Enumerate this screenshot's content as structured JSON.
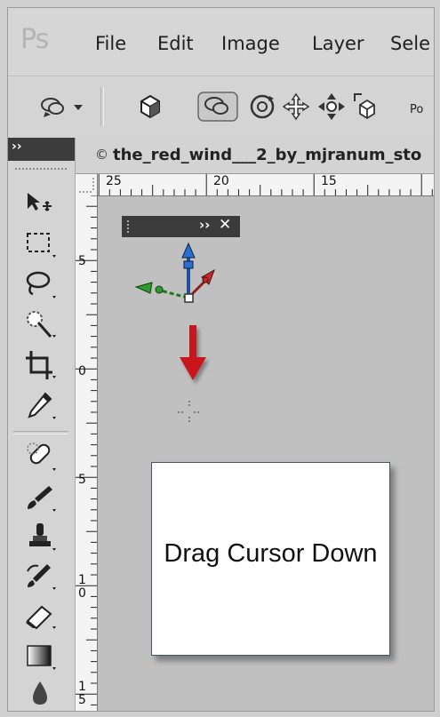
{
  "app": {
    "logo": "Ps"
  },
  "menu": {
    "items": [
      "File",
      "Edit",
      "Image",
      "Layer",
      "Sele"
    ]
  },
  "options_bar": {
    "truncated_label": "Po"
  },
  "tool_panel": {
    "collapse_glyph": "››"
  },
  "document": {
    "close_glyph": "©",
    "title": "the_red_wind___2_by_mjranum_sto"
  },
  "rulers": {
    "horizontal_labels": [
      "25",
      "20",
      "15"
    ],
    "vertical_labels": [
      "5",
      "0",
      "5",
      "1\n0",
      "1\n5"
    ]
  },
  "mini_panel": {
    "expand_glyph": "››",
    "close_glyph": "✕"
  },
  "callout": {
    "text": "Drag Cursor Down"
  },
  "colors": {
    "arrow_red": "#c8161d",
    "axis_blue": "#2a6fd6",
    "axis_green": "#2e9a2e",
    "axis_red": "#c82a2a",
    "canvas_gray": "#c0c0c0"
  }
}
